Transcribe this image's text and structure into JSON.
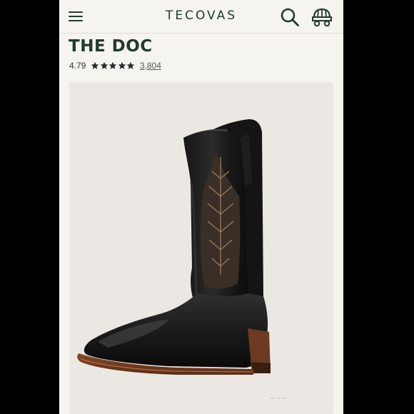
{
  "app": {
    "brand": "TECOVAS"
  },
  "header": {
    "menu_icon": "hamburger-menu-icon",
    "search_icon": "search-icon",
    "cart_icon": "wagon-cart-icon"
  },
  "product": {
    "name": "THE DOC",
    "rating": "4.79",
    "stars": 5,
    "review_count": "3,804"
  },
  "gallery": {
    "image": "black-cowboy-boot-image",
    "total_slides": 4,
    "active_slide": 1
  },
  "colors": {
    "brand_green": "#1f3b2b",
    "background": "#f6f4ee",
    "image_bg": "#ebe8e3"
  }
}
